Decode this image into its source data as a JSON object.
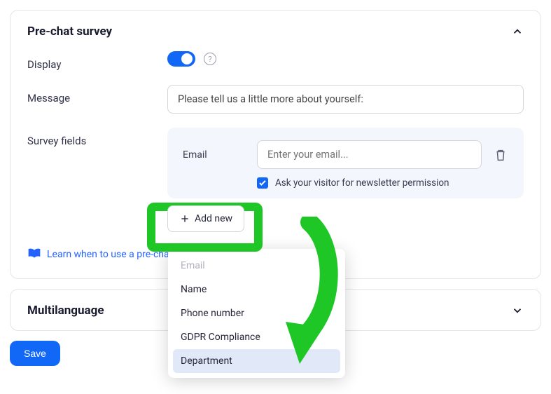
{
  "panel1": {
    "title": "Pre-chat survey",
    "display_label": "Display",
    "message_label": "Message",
    "message_value": "Please tell us a little more about yourself:",
    "survey_fields_label": "Survey fields",
    "field": {
      "label": "Email",
      "placeholder": "Enter your email..."
    },
    "newsletter_label": "Ask your visitor for newsletter permission",
    "add_new_label": "Add new",
    "learn_link": "Learn when to use a pre-chat survey"
  },
  "panel2": {
    "title": "Multilanguage"
  },
  "save_label": "Save",
  "dropdown": {
    "items": [
      "Email",
      "Name",
      "Phone number",
      "GDPR Compliance",
      "Department"
    ]
  }
}
